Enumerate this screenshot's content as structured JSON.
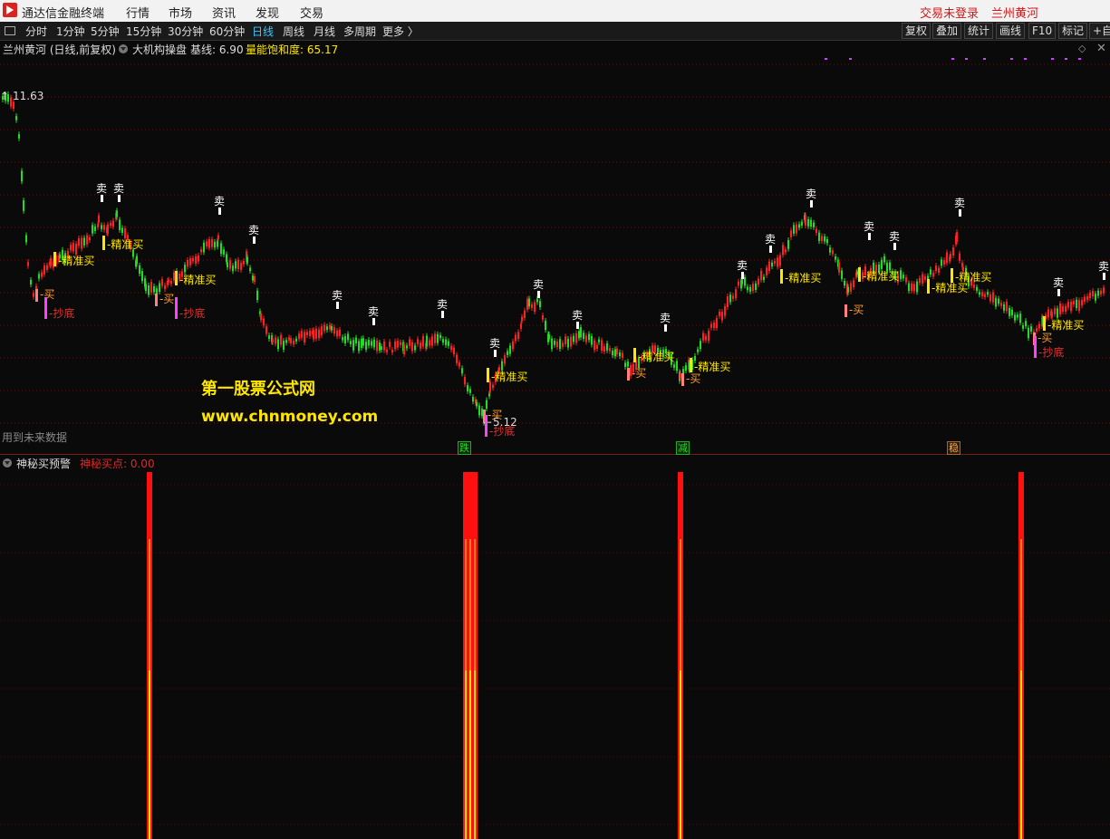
{
  "titlebar": {
    "app_title": "通达信金融终端",
    "menu": [
      "行情",
      "市场",
      "资讯",
      "发现",
      "交易"
    ],
    "login_status": "交易未登录",
    "stock_name": "兰州黄河"
  },
  "toolbar": {
    "periods": [
      "分时",
      "1分钟",
      "5分钟",
      "15分钟",
      "30分钟",
      "60分钟",
      "日线",
      "周线",
      "月线",
      "多周期",
      "更多 〉"
    ],
    "active_period": "日线",
    "right_buttons": [
      "复权",
      "叠加",
      "统计",
      "画线",
      "F10",
      "标记",
      "+自"
    ]
  },
  "main_chart": {
    "header_stock": "兰州黄河 (日线,前复权)",
    "indicator_name": "大机构操盘",
    "baseline_label": "基线: 6.90",
    "saturation_label": "量能饱和度: 65.17",
    "high_label": "11.63",
    "low_label": "5.12",
    "future_note": "用到未来数据",
    "watermark_title": "第一股票公式网",
    "watermark_url": "www.chnmoney.com",
    "sell_label": "卖",
    "buy_label": "买",
    "precise_buy_label": "精准买",
    "bottom_label": "抄底",
    "bottom_markers": [
      "跌",
      "减",
      "稳"
    ],
    "colors": {
      "up": "#ff2020",
      "down": "#22dd22",
      "sell": "#ffffff",
      "buy": "#ff8080",
      "precise_buy": "#ffe600",
      "bottom": "#ff40ff",
      "grid": "#5a1515"
    }
  },
  "sub_chart": {
    "title": "神秘买预警",
    "value_label": "神秘买点: 0.00",
    "colors": {
      "bar": "#ff1010",
      "core": "#ffe600"
    }
  },
  "chart_data": {
    "type": "candlestick",
    "title": "兰州黄河 (日线,前复权)",
    "price_high": 11.63,
    "price_low": 5.12,
    "baseline": 6.9,
    "volume_saturation": 65.17,
    "signal_value": 0.0
  }
}
